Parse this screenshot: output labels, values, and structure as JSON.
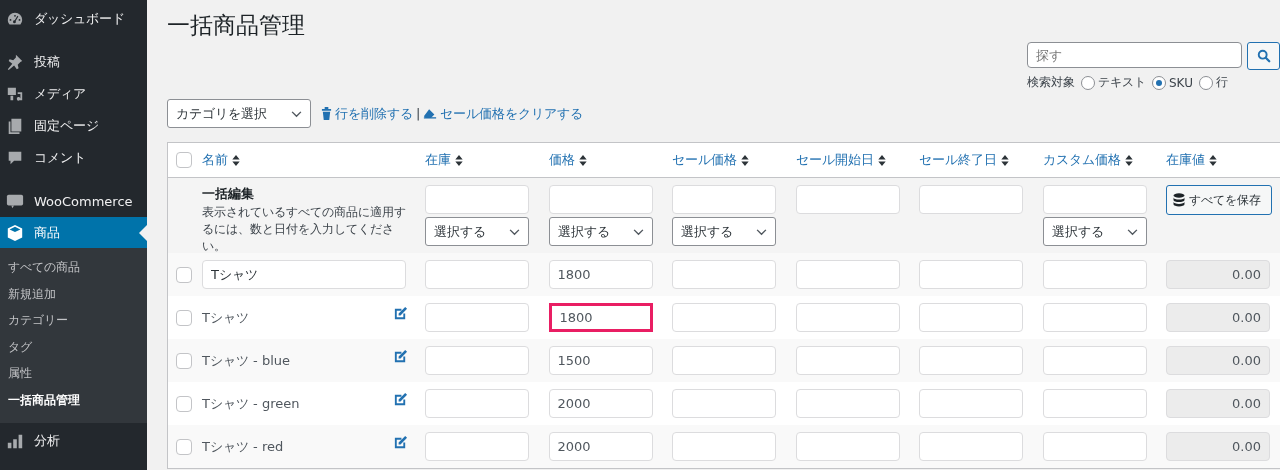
{
  "sidebar": {
    "items": [
      {
        "label": "ダッシュボード",
        "selected": false
      },
      {
        "label": "投稿",
        "selected": false
      },
      {
        "label": "メディア",
        "selected": false
      },
      {
        "label": "固定ページ",
        "selected": false
      },
      {
        "label": "コメント",
        "selected": false
      },
      {
        "label": "WooCommerce",
        "selected": false
      },
      {
        "label": "商品",
        "selected": true,
        "children": [
          {
            "label": "すべての商品",
            "selected": false
          },
          {
            "label": "新規追加",
            "selected": false
          },
          {
            "label": "カテゴリー",
            "selected": false
          },
          {
            "label": "タグ",
            "selected": false
          },
          {
            "label": "属性",
            "selected": false
          },
          {
            "label": "一括商品管理",
            "selected": true
          }
        ]
      },
      {
        "label": "分析",
        "selected": false
      }
    ]
  },
  "page": {
    "title": "一括商品管理"
  },
  "search": {
    "placeholder": "探す",
    "target_label": "検索対象",
    "options": [
      {
        "label": "テキスト",
        "selected": false
      },
      {
        "label": "SKU",
        "selected": true
      },
      {
        "label": "行",
        "selected": false
      }
    ]
  },
  "toolbar": {
    "category_select": "カテゴリを選択",
    "links": [
      {
        "label": "行を削除する",
        "kind": "delete"
      },
      {
        "label": "セール価格をクリアする",
        "kind": "clear"
      }
    ],
    "separator": "|"
  },
  "table": {
    "select_all_checked": false,
    "columns": [
      {
        "label": "名前"
      },
      {
        "label": "在庫"
      },
      {
        "label": "価格"
      },
      {
        "label": "セール価格"
      },
      {
        "label": "セール開始日"
      },
      {
        "label": "セール終了日"
      },
      {
        "label": "カスタム価格"
      },
      {
        "label": "在庫値"
      }
    ],
    "bulk_edit": {
      "title": "一括編集",
      "description": "表示されているすべての商品に適用するには、数と日付を入力してください。",
      "cells": [
        {
          "kind": "input-select",
          "select": "選択する"
        },
        {
          "kind": "input-select",
          "select": "選択する"
        },
        {
          "kind": "input-select",
          "select": "選択する"
        },
        {
          "kind": "input"
        },
        {
          "kind": "input"
        },
        {
          "kind": "input-select",
          "select": "選択する"
        },
        {
          "kind": "button",
          "button": "すべてを保存"
        }
      ]
    },
    "rows": [
      {
        "kind": "name-field",
        "checked": false,
        "name": "Tシャツ",
        "price": "1800",
        "price_highlighted": false,
        "stock_value": "0.00"
      },
      {
        "kind": "name-text",
        "checked": false,
        "name": "Tシャツ",
        "price": "1800",
        "price_highlighted": true,
        "stock_value": "0.00"
      },
      {
        "kind": "name-text",
        "checked": false,
        "name": "Tシャツ - blue",
        "price": "1500",
        "price_highlighted": false,
        "stock_value": "0.00"
      },
      {
        "kind": "name-text",
        "checked": false,
        "name": "Tシャツ - green",
        "price": "2000",
        "price_highlighted": false,
        "stock_value": "0.00"
      },
      {
        "kind": "name-text",
        "checked": false,
        "name": "Tシャツ - red",
        "price": "2000",
        "price_highlighted": false,
        "stock_value": "0.00"
      }
    ]
  }
}
